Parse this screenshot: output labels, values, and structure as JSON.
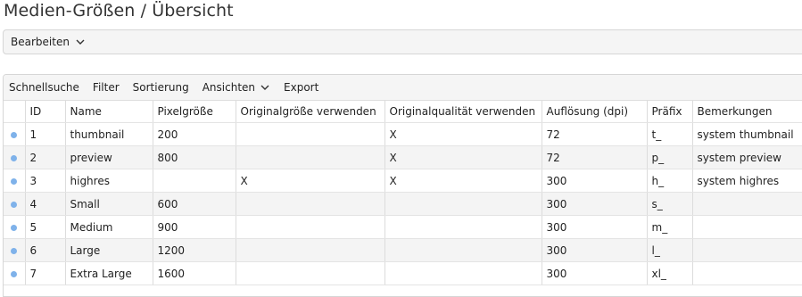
{
  "page": {
    "title": "Medien-Größen / Übersicht"
  },
  "edit_menu": {
    "label": "Bearbeiten",
    "icon": "chevron-down-icon"
  },
  "toolbar": {
    "items": [
      "Schnellsuche",
      "Filter",
      "Sortierung",
      "Ansichten",
      "Export"
    ],
    "dropdown_icon": "chevron-down-icon"
  },
  "table": {
    "columns": [
      "ID",
      "Name",
      "Pixelgröße",
      "Originalgröße verwenden",
      "Originalqualität verwenden",
      "Auflösung (dpi)",
      "Präfix",
      "Bemerkungen"
    ],
    "row_marker_color": "#7fb2ea",
    "rows": [
      [
        "1",
        "thumbnail",
        "200",
        "",
        "X",
        "72",
        "t_",
        "system thumbnail"
      ],
      [
        "2",
        "preview",
        "800",
        "",
        "X",
        "72",
        "p_",
        "system preview"
      ],
      [
        "3",
        "highres",
        "",
        "X",
        "X",
        "300",
        "h_",
        "system highres"
      ],
      [
        "4",
        "Small",
        "600",
        "",
        "",
        "300",
        "s_",
        ""
      ],
      [
        "5",
        "Medium",
        "900",
        "",
        "",
        "300",
        "m_",
        ""
      ],
      [
        "6",
        "Large",
        "1200",
        "",
        "",
        "300",
        "l_",
        ""
      ],
      [
        "7",
        "Extra Large",
        "1600",
        "",
        "",
        "300",
        "xl_",
        ""
      ]
    ]
  }
}
